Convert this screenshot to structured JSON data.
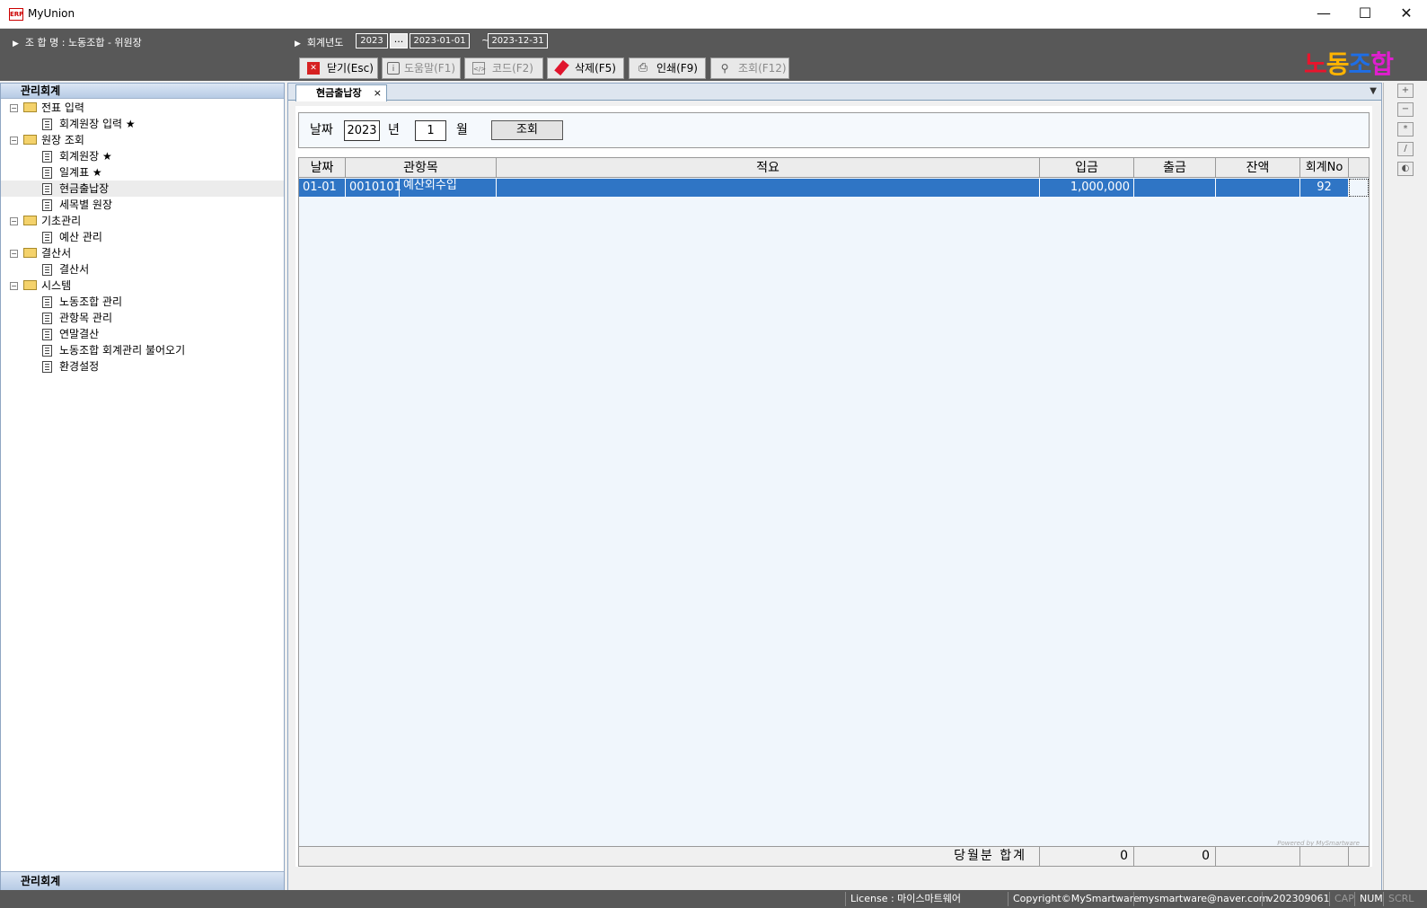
{
  "window": {
    "title": "MyUnion",
    "icon_text": "ERP"
  },
  "header": {
    "union_label": "조 합 명 : 노동조합 - 위원장",
    "fiscal_year_label": "회계년도",
    "fiscal_year": "2023",
    "fy_picker_label": "...",
    "date_from": "2023-01-01",
    "tilde": "~",
    "date_to": "2023-12-31",
    "logo": {
      "part1": "노",
      "part2": "동",
      "part3": "조",
      "part4": "합"
    }
  },
  "toolbar": {
    "close_label": "닫기(Esc)",
    "help_label": "도움말(F1)",
    "code_label": "코드(F2)",
    "delete_label": "삭제(F5)",
    "print_label": "인쇄(F9)",
    "search_label": "조회(F12)"
  },
  "sidebar": {
    "header": "관리회계",
    "footer": "관리회계",
    "groups": [
      {
        "label": "전표 입력",
        "items": [
          "회계원장 입력 ★"
        ]
      },
      {
        "label": "원장 조회",
        "items": [
          "회계원장 ★",
          "일계표 ★",
          "현금출납장",
          "세목별 원장"
        ]
      },
      {
        "label": "기초관리",
        "items": [
          "예산 관리"
        ]
      },
      {
        "label": "결산서",
        "items": [
          "결산서"
        ]
      },
      {
        "label": "시스템",
        "items": [
          "노동조합 관리",
          "관항목 관리",
          "연말결산",
          "노동조합 회계관리 불어오기",
          "환경설정"
        ]
      }
    ],
    "selected_item": "현금출납장"
  },
  "tab": {
    "label": "현금출납장",
    "close": "×"
  },
  "search": {
    "date_label": "날짜",
    "year": "2023",
    "year_label": "년",
    "month": "1",
    "month_label": "월",
    "query_button": "조회"
  },
  "grid": {
    "columns": [
      "날짜",
      "관항목",
      "적요",
      "입금",
      "출금",
      "잔액",
      "회계No"
    ],
    "rows": [
      {
        "date": "01-01",
        "code": "0010101",
        "account": "예산외수입",
        "memo": "",
        "deposit": "1,000,000",
        "withdraw": "",
        "balance": "",
        "no": "92"
      }
    ],
    "footer": {
      "label": "당월분 합계",
      "deposit_total": "0",
      "withdraw_total": "0"
    }
  },
  "powered_by": "Powered by MySmartware",
  "right_tools": [
    "+",
    "−",
    "*",
    "/",
    "◐"
  ],
  "status": {
    "license": "License : 마이스마트웨어",
    "copyright": "Copyright©MySmartware",
    "email": "mysmartware@naver.com",
    "version": "v202309061",
    "cap": "CAP",
    "num": "NUM",
    "scrl": "SCRL"
  },
  "colors": {
    "selected_row": "#2f75c5",
    "topbar": "#585858",
    "logo1": "#e8142c",
    "logo2": "#ffb400",
    "logo3": "#1e6ee6",
    "logo4": "#e01ecf"
  }
}
